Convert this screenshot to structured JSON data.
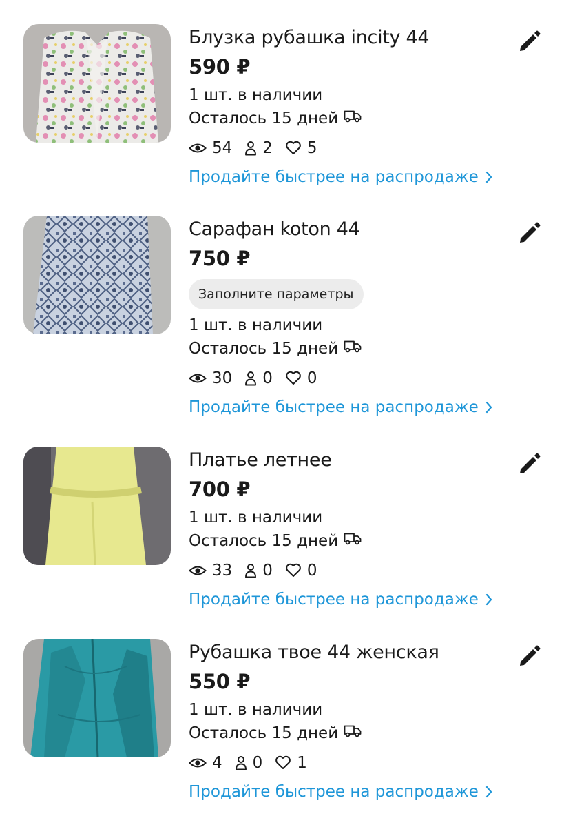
{
  "listings": [
    {
      "title": "Блузка рубашка incity 44",
      "price": "590 ₽",
      "stock": "1 шт. в наличии",
      "remaining": "Осталось 15 дней",
      "views": "54",
      "contacts": "2",
      "favorites": "5",
      "promo": "Продайте быстрее на распродаже"
    },
    {
      "title": "Сарафан koton 44",
      "price": "750 ₽",
      "badge": "Заполните параметры",
      "stock": "1 шт. в наличии",
      "remaining": "Осталось 15 дней",
      "views": "30",
      "contacts": "0",
      "favorites": "0",
      "promo": "Продайте быстрее на распродаже"
    },
    {
      "title": "Платье летнее",
      "price": "700 ₽",
      "stock": "1 шт. в наличии",
      "remaining": "Осталось 15 дней",
      "views": "33",
      "contacts": "0",
      "favorites": "0",
      "promo": "Продайте быстрее на распродаже"
    },
    {
      "title": "Рубашка твое 44 женская",
      "price": "550 ₽",
      "stock": "1 шт. в наличии",
      "remaining": "Осталось 15 дней",
      "views": "4",
      "contacts": "0",
      "favorites": "1",
      "promo": "Продайте быстрее на распродаже"
    }
  ],
  "icons": {
    "edit": "pencil-icon",
    "views": "eye-icon",
    "contacts": "person-icon",
    "favorites": "heart-icon",
    "delivery": "truck-icon",
    "promo_arrow": "chevron-right-icon"
  },
  "colors": {
    "promo_link": "#1e96d8",
    "badge_bg": "#ececec",
    "text": "#1a1a1a"
  }
}
